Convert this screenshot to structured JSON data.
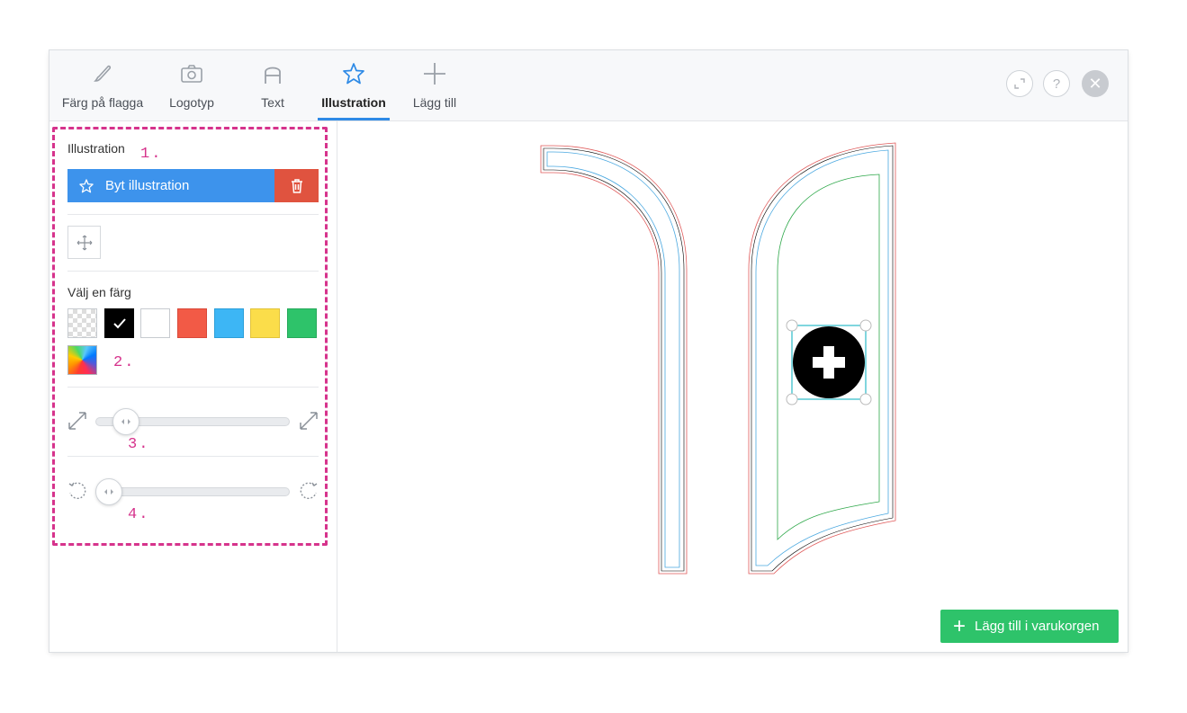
{
  "tabs": [
    {
      "label": "Färg på flagga",
      "icon": "brush-icon"
    },
    {
      "label": "Logotyp",
      "icon": "camera-icon"
    },
    {
      "label": "Text",
      "icon": "letter-a-icon"
    },
    {
      "label": "Illustration",
      "icon": "star-icon",
      "active": true
    },
    {
      "label": "Lägg till",
      "icon": "plus-icon"
    }
  ],
  "header_buttons": {
    "fullscreen_icon": "expand-icon",
    "help_label": "?",
    "close_label": "✕"
  },
  "sidebar": {
    "illustration_title": "Illustration",
    "marker_1": "1.",
    "change_button_label": "Byt illustration",
    "color_title": "Välj en färg",
    "marker_2": "2.",
    "marker_3": "3.",
    "marker_4": "4.",
    "colors": [
      "transparent",
      "#000000",
      "#ffffff",
      "#f25a46",
      "#3db6f5",
      "#fbdd4a",
      "#2ec36a",
      "gradient"
    ],
    "selected_color": "#000000",
    "size_slider_value": 0.1,
    "rotate_slider_value": 0.0
  },
  "colors": {
    "accent": "#2e8ae6",
    "delete": "#e0533f",
    "cart": "#2ec36a",
    "marker": "#d6338c"
  },
  "cart_button_label": "Lägg till i varukorgen"
}
